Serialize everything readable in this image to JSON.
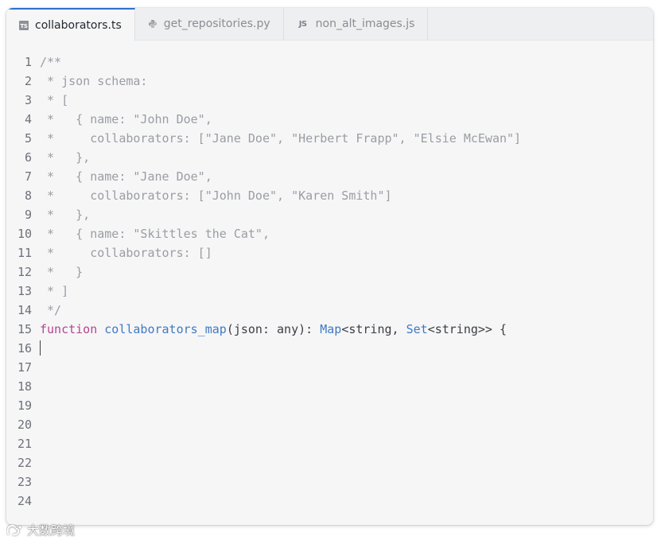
{
  "tabs": [
    {
      "label": "collaborators.ts",
      "icon": "typescript-icon",
      "icon_text": "TS",
      "active": true
    },
    {
      "label": "get_repositories.py",
      "icon": "python-icon",
      "active": false
    },
    {
      "label": "non_alt_images.js",
      "icon": "javascript-icon",
      "icon_text": "JS",
      "active": false
    }
  ],
  "code": {
    "lines": [
      {
        "number": "1",
        "text": "/**"
      },
      {
        "number": "2",
        "text": " * json schema:"
      },
      {
        "number": "3",
        "text": " * ["
      },
      {
        "number": "4",
        "text": " *   { name: \"John Doe\","
      },
      {
        "number": "5",
        "text": " *     collaborators: [\"Jane Doe\", \"Herbert Frapp\", \"Elsie McEwan\"]"
      },
      {
        "number": "6",
        "text": " *   },"
      },
      {
        "number": "7",
        "text": " *   { name: \"Jane Doe\","
      },
      {
        "number": "8",
        "text": " *     collaborators: [\"John Doe\", \"Karen Smith\"]"
      },
      {
        "number": "9",
        "text": " *   },"
      },
      {
        "number": "10",
        "text": " *   { name: \"Skittles the Cat\","
      },
      {
        "number": "11",
        "text": " *     collaborators: []"
      },
      {
        "number": "12",
        "text": " *   }"
      },
      {
        "number": "13",
        "text": " * ]"
      },
      {
        "number": "14",
        "text": " */"
      }
    ],
    "function_line": {
      "number": "15",
      "keyword": "function",
      "name": "collaborators_map",
      "params": "(json: any): ",
      "return_type": "Map",
      "type_args_open": "<string, ",
      "inner_type": "Set",
      "type_args_close": "<string>> {"
    },
    "cursor_line_number": "16",
    "empty_line_numbers": [
      "17",
      "18",
      "19",
      "20",
      "21",
      "22",
      "23",
      "24"
    ]
  },
  "watermark": {
    "text": "大数跨境",
    "icon": "brand-logo-icon"
  },
  "colors": {
    "keyword": "#b4468f",
    "function": "#3f7ac2",
    "comment": "#9a9da3",
    "active_tab_accent": "#2f6fd0"
  }
}
